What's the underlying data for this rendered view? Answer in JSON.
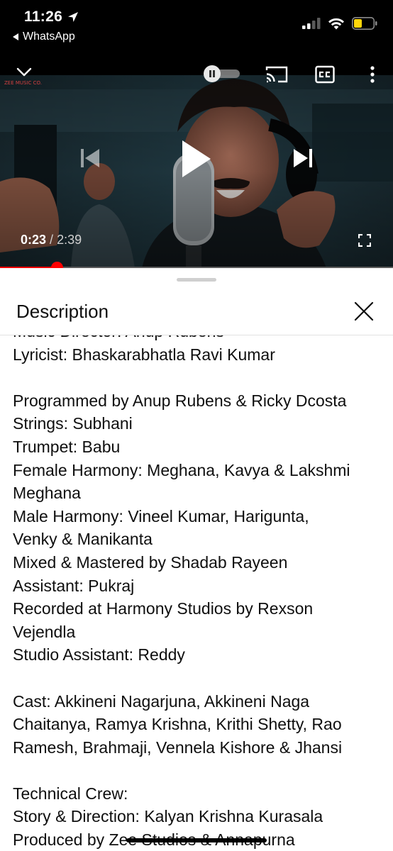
{
  "status_bar": {
    "time": "11:26",
    "back_app": "WhatsApp",
    "battery_color": "#ffd60a"
  },
  "player": {
    "current_time": "0:23",
    "separator": "/",
    "duration": "2:39",
    "progress_fraction": 0.145,
    "buffered_fraction": 0.14,
    "channel_watermark": "ZEE MUSIC CO.",
    "accent_color": "#ff0000",
    "icons": [
      "minimize-chevron-icon",
      "autoplay-toggle",
      "cast-icon",
      "captions-icon",
      "more-vert-icon",
      "previous-icon",
      "play-icon",
      "next-icon",
      "fullscreen-icon"
    ]
  },
  "description_sheet": {
    "title": "Description",
    "close_icon": "close-icon",
    "text": "Music Director: Anup Rubens\nLyricist: Bhaskarabhatla Ravi Kumar\n\nProgrammed by Anup Rubens & Ricky Dcosta\nStrings: Subhani\nTrumpet: Babu\nFemale Harmony: Meghana, Kavya & Lakshmi\nMeghana\nMale Harmony: Vineel Kumar, Harigunta,\nVenky & Manikanta\nMixed & Mastered by Shadab Rayeen\nAssistant: Pukraj\nRecorded at Harmony Studios by Rexson\nVejendla\nStudio Assistant: Reddy\n\nCast: Akkineni Nagarjuna, Akkineni Naga\nChaitanya, Ramya Krishna, Krithi Shetty, Rao\nRamesh, Brahmaji, Vennela Kishore & Jhansi\n\nTechnical Crew:\nStory & Direction: Kalyan Krishna Kurasala\nProduced by Zee Studios & Annapurna"
  }
}
